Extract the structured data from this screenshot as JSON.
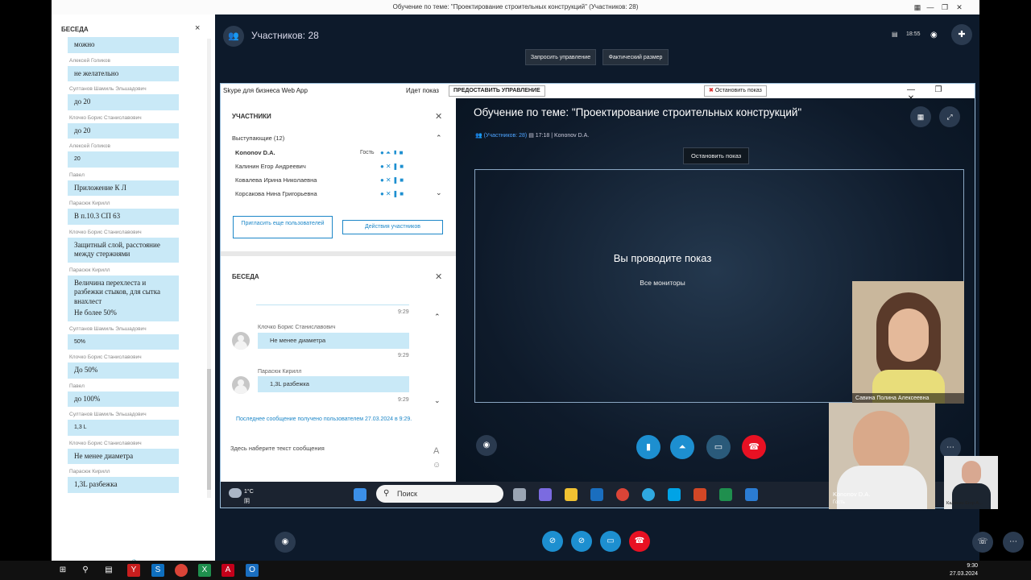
{
  "window_title": "Обучение по теме: \"Проектирование строительных конструкций\" (Участников: 28)",
  "left_chat": {
    "title": "БЕСЕДА",
    "close": "×",
    "messages": [
      {
        "name": "",
        "text": "можно"
      },
      {
        "name": "Алексей Голиков",
        "text": "не желательно"
      },
      {
        "name": "Султанов Шамиль Эльшадович",
        "text": "до 20"
      },
      {
        "name": "Клочко Борис Станиславович",
        "text": "до 20"
      },
      {
        "name": "Алексей Голиков",
        "text": "20"
      },
      {
        "name": "Павел",
        "text": "Приложение К Л"
      },
      {
        "name": "Парасюк Кирилл",
        "text": "В п.10.3 СП 63"
      },
      {
        "name": "Клочко Борис Станиславович",
        "text": "Защитный слой, расстояние между стержнями"
      },
      {
        "name": "Парасюк Кирилл",
        "text": "Величина перехлеста и разбежки стыков, для сытка внахлест",
        "text2": "Не более 50%"
      },
      {
        "name": "Султанов Шамиль Эльшадович",
        "text": "50%"
      },
      {
        "name": "Клочко Борис Станиславович",
        "text": "До 50%"
      },
      {
        "name": "Павел",
        "text": "до 100%"
      },
      {
        "name": "Султанов Шамиль Эльшадович",
        "text": "1,3 L"
      },
      {
        "name": "Клочко Борис Станиславович",
        "text": "Не менее диаметра"
      },
      {
        "name": "Парасюк Кирилл",
        "text": "1,3L разбежка"
      }
    ]
  },
  "top_bar": {
    "participants_label": "Участников: 28",
    "request_control": "Запросить управление",
    "actual_size": "Фактический размер",
    "time": "18:55"
  },
  "inner_window": {
    "app_title": "Skype для бизнеса Web App",
    "sharing_label": "Идет показ",
    "give_control": "ПРЕДОСТАВИТЬ УПРАВЛЕНИЕ",
    "stop_sharing": "Остановить показ"
  },
  "participants_pane": {
    "title": "УЧАСТНИКИ",
    "speakers_label": "Выступающие (12)",
    "rows": [
      {
        "name": "Kononov D.A.",
        "role": "Гость"
      },
      {
        "name": "Калинин Егор Андреевич",
        "role": ""
      },
      {
        "name": "Ковалева Ирина Николаевна",
        "role": ""
      },
      {
        "name": "Корсакова Нина Григорьевна",
        "role": ""
      }
    ],
    "invite_button": "Пригласить еще пользователей",
    "actions_button": "Действия участников"
  },
  "inner_chat": {
    "title": "БЕСЕДА",
    "messages": [
      {
        "time": "9:29"
      },
      {
        "name": "Клочко Борис Станиславович",
        "text": "Не менее диаметра",
        "time": "9:29"
      },
      {
        "name": "Парасюк Кирилл",
        "text": "1,3L разбежка",
        "time": "9:29"
      }
    ],
    "last_message": "Последнее сообщение получено пользователем 27.03.2024 в 9:29.",
    "input_placeholder": "Здесь наберите текст сообщения"
  },
  "meeting": {
    "title": "Обучение по теме: \"Проектирование строительных конструкций\"",
    "participants_link": "(Участников: 28)",
    "time": "17:18",
    "presenter": "Kononov D.A.",
    "stop_button": "Остановить показ",
    "presenting_text": "Вы проводите показ",
    "monitors_text": "Все мониторы",
    "video1_name": "Савина Полина Алексеевна"
  },
  "inner_taskbar": {
    "temperature": "1°C",
    "weather": "阴",
    "search": "Поиск"
  },
  "overlay_videos": {
    "kononov_name": "Kononov D.A.",
    "kononov_role": "Гость",
    "kalinin_name": "Калинин Егор А..."
  },
  "clock": {
    "time": "9:30",
    "date": "27.03.2024"
  },
  "colors": {
    "accent": "#1d87c8",
    "bubble": "#c9e9f7",
    "stage_bg": "#0e1a2a",
    "end_call": "#e81123"
  }
}
